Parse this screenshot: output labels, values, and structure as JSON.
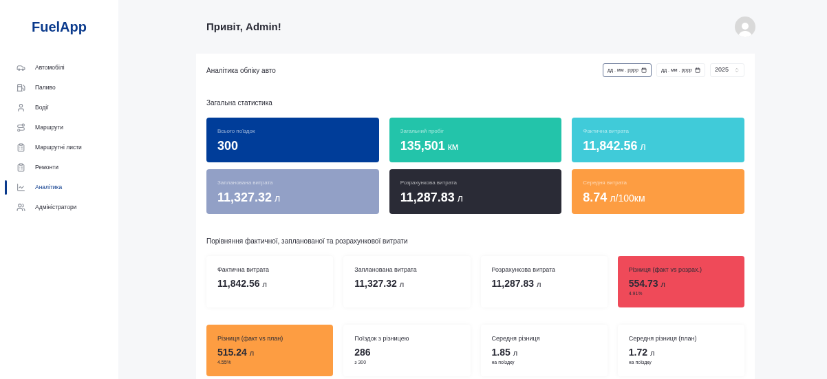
{
  "sidebar": {
    "logo": "FuelApp",
    "items": [
      {
        "label": "Автомобілі",
        "selected": false
      },
      {
        "label": "Паливо",
        "selected": false
      },
      {
        "label": "Водії",
        "selected": false
      },
      {
        "label": "Маршрути",
        "selected": false
      },
      {
        "label": "Маршрутні листи",
        "selected": false
      },
      {
        "label": "Ремонти",
        "selected": false
      },
      {
        "label": "Аналітика",
        "selected": true
      },
      {
        "label": "Адміністратори",
        "selected": false
      }
    ]
  },
  "header": {
    "greeting": "Привіт, Admin!"
  },
  "panel": {
    "title": "Аналітика обліку авто",
    "filters": [
      {
        "kind": "date",
        "placeholder": "дд . мм . рррр",
        "focused": true
      },
      {
        "kind": "date",
        "placeholder": "дд . мм . рррр",
        "focused": false
      },
      {
        "kind": "year",
        "value": "2025",
        "focused": false
      }
    ],
    "general": {
      "heading": "Загальна статистика",
      "cards": [
        {
          "label": "Всього поїздок",
          "value": "300",
          "color": "#003d99"
        },
        {
          "label": "Загальний пробіг",
          "value": "135,501",
          "unit": "км",
          "color": "#23c4aa"
        },
        {
          "label": "Фактична витрата",
          "value": "11,842.56",
          "unit": "л",
          "color": "#40cbd9"
        },
        {
          "label": "Запланована витрата",
          "value": "11,327.32",
          "unit": "л",
          "color": "#92a0c6"
        },
        {
          "label": "Розрахункова витрата",
          "value": "11,287.83",
          "unit": "л",
          "color": "#2a2b36"
        },
        {
          "label": "Середня витрата",
          "value": "8.74",
          "unit": "л/100км",
          "color": "#fd9d42"
        }
      ]
    },
    "comparison": {
      "heading": "Порівняння фактичної, запланованої та розрахункової витрати",
      "cards": [
        {
          "label": "Фактична витрата",
          "value": "11,842.56",
          "unit": "л"
        },
        {
          "label": "Запланована витрата",
          "value": "11,327.32",
          "unit": "л"
        },
        {
          "label": "Розрахункова витрата",
          "value": "11,287.83",
          "unit": "л"
        },
        {
          "label": "Різниця (факт vs розрах.)",
          "value": "554.73",
          "unit": "л",
          "note": "4.91%",
          "color": "#ef4a59"
        },
        {
          "label": "Різниця (факт vs план)",
          "value": "515.24",
          "unit": "л",
          "note": "4.55%",
          "color": "#fd9d42"
        },
        {
          "label": "Поїздок з різницею",
          "value": "286",
          "note": "з 300"
        },
        {
          "label": "Середня різниця",
          "value": "1.85",
          "unit": "л",
          "note": "на поїздку"
        },
        {
          "label": "Середня різниця (план)",
          "value": "1.72",
          "unit": "л",
          "note": "на поїздку"
        }
      ]
    }
  }
}
